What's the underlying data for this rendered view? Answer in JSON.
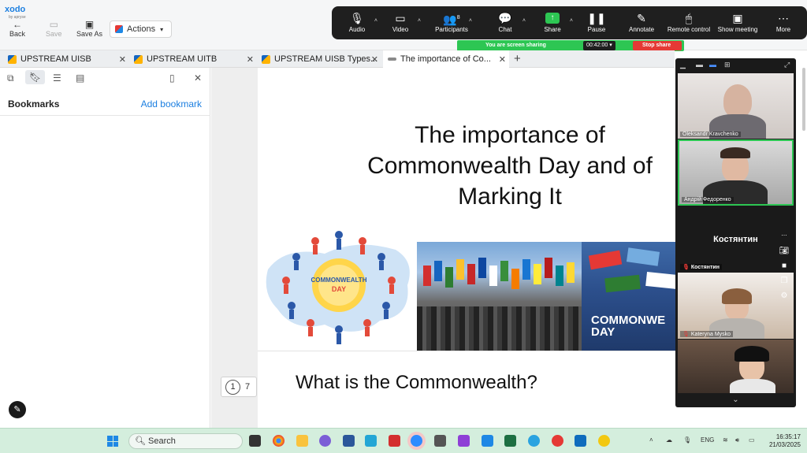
{
  "xodo": {
    "logo_text": "xodo",
    "logo_sub": "by apryse",
    "toolbar": {
      "back_label": "Back",
      "save_label": "Save",
      "save_as_label": "Save As",
      "actions_label": "Actions"
    },
    "tabs": [
      {
        "label": "UPSTREAM UISB"
      },
      {
        "label": "UPSTREAM UITB"
      },
      {
        "label": "UPSTREAM UISB Types..."
      },
      {
        "label": "The importance of Co..."
      }
    ],
    "bookmarks": {
      "title": "Bookmarks",
      "add_label": "Add bookmark"
    },
    "pager": {
      "current": "1",
      "total": "7"
    }
  },
  "slide": {
    "title_line1": "The importance of",
    "title_line2": "Commonwealth Day and of",
    "title_line3": "Marking It",
    "logo_text_line1": "COMMONWEALTH",
    "logo_text_line2": "DAY",
    "photo_caption_line1": "COMMONWE",
    "photo_caption_line2": "DAY",
    "question": "What is the Commonwealth?"
  },
  "zoom": {
    "controls": [
      {
        "label": "Audio",
        "icon": "microphone-icon"
      },
      {
        "label": "Video",
        "icon": "video-camera-icon"
      },
      {
        "label": "Participants",
        "icon": "participants-icon",
        "count": "8"
      },
      {
        "label": "Chat",
        "icon": "chat-icon"
      },
      {
        "label": "Share",
        "icon": "share-screen-icon"
      },
      {
        "label": "Pause",
        "icon": "pause-icon"
      },
      {
        "label": "Annotate",
        "icon": "annotate-icon"
      },
      {
        "label": "Remote control",
        "icon": "remote-control-icon"
      },
      {
        "label": "Show meeting",
        "icon": "show-meeting-icon"
      },
      {
        "label": "More",
        "icon": "more-icon"
      }
    ],
    "sharing_status": "You are screen sharing",
    "timer": "00:42:00",
    "stop_share_label": "Stop share",
    "participants": [
      {
        "name": "Oleksandr Kravchenko"
      },
      {
        "name": "Андрій Федоренко"
      },
      {
        "name": "Костянтин",
        "display_name": "Костянтин"
      },
      {
        "name": "Kateryna Mysko"
      },
      {
        "name": ""
      }
    ]
  },
  "taskbar": {
    "search_label": "Search",
    "language": "ENG",
    "time": "16:35:17",
    "date": "21/03/2025"
  },
  "colors": {
    "accent_blue": "#1c7fe0",
    "zoom_green": "#2dc653",
    "stop_red": "#e53935",
    "taskbar_bg": "#d4eedd"
  }
}
